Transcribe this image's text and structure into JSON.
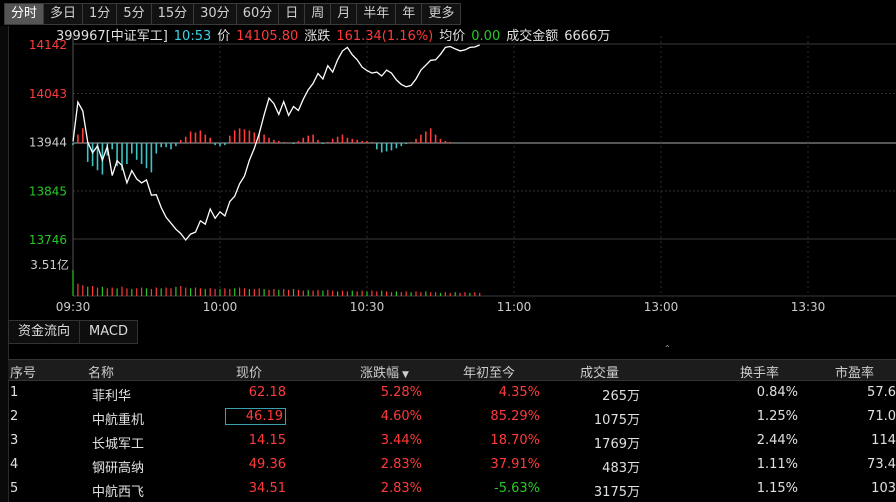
{
  "period_tabs": [
    "分时",
    "多日",
    "1分",
    "5分",
    "15分",
    "30分",
    "60分",
    "日",
    "周",
    "月",
    "半年",
    "年",
    "更多"
  ],
  "active_tab": "分时",
  "info": {
    "code": "399967[中证军工]",
    "time": "10:53",
    "price_label": "价",
    "price": "14105.80",
    "change_label": "涨跌",
    "change": "161.34(1.16%)",
    "avg_label": "均价",
    "avg": "0.00",
    "turnover_label": "成交金额",
    "turnover": "6666万"
  },
  "price_axis": [
    "14142",
    "14043",
    "13944",
    "13845",
    "13746"
  ],
  "volume_axis_label": "3.51亿",
  "time_axis": [
    "09:30",
    "10:00",
    "10:30",
    "11:00",
    "13:00",
    "13:30"
  ],
  "colors": {
    "up": "#ff3b3b",
    "down": "#26c926",
    "macd_down": "#3ec4c4",
    "line": "#ffffff",
    "cyan": "#3cd4e0"
  },
  "chart_data": {
    "type": "line",
    "x_range": [
      "09:30",
      "13:30"
    ],
    "y_range": [
      13746,
      14142
    ],
    "price_minutes": [
      0,
      1,
      2,
      3,
      4,
      5,
      6,
      7,
      8,
      9,
      10,
      11,
      12,
      13,
      14,
      15,
      16,
      17,
      18,
      19,
      20,
      21,
      22,
      23,
      24,
      25,
      26,
      27,
      28,
      29,
      30,
      31,
      32,
      33,
      34,
      35,
      36,
      37,
      38,
      39,
      40,
      41,
      42,
      43,
      44,
      45,
      46,
      47,
      48,
      49,
      50,
      51,
      52,
      53,
      54,
      55,
      56,
      57,
      58,
      59,
      60,
      61,
      62,
      63,
      64,
      65,
      66,
      67,
      68,
      69,
      70,
      71,
      72,
      73,
      74,
      75,
      76,
      77,
      78,
      79,
      80,
      81,
      82,
      83
    ],
    "price_values": [
      13944,
      14024,
      14006,
      13943,
      13921,
      13935,
      13906,
      13934,
      13875,
      13905,
      13895,
      13860,
      13885,
      13868,
      13860,
      13866,
      13835,
      13836,
      13810,
      13790,
      13778,
      13766,
      13757,
      13744,
      13756,
      13760,
      13783,
      13776,
      13807,
      13788,
      13801,
      13793,
      13822,
      13833,
      13858,
      13874,
      13906,
      13930,
      13960,
      13998,
      14032,
      14021,
      13999,
      14025,
      13997,
      14015,
      14007,
      14030,
      14049,
      14062,
      14082,
      14071,
      14098,
      14085,
      14110,
      14128,
      14135,
      14120,
      14110,
      14095,
      14088,
      14083,
      14085,
      14077,
      14089,
      14083,
      14069,
      14060,
      14055,
      14058,
      14071,
      14089,
      14099,
      14109,
      14110,
      14121,
      14135,
      14137,
      14132,
      14128,
      14130,
      14135,
      14136,
      14140
    ],
    "macd_values": [
      -2,
      8,
      14,
      -18,
      -22,
      -26,
      -30,
      -12,
      -6,
      -22,
      -26,
      -20,
      -10,
      -16,
      -20,
      -24,
      -28,
      -10,
      -4,
      -4,
      -6,
      -3,
      3,
      6,
      11,
      10,
      12,
      8,
      5,
      -2,
      -3,
      -2,
      7,
      12,
      14,
      13,
      12,
      10,
      9,
      8,
      5,
      3,
      2,
      1,
      0,
      -1,
      2,
      5,
      7,
      8,
      3,
      -1,
      1,
      4,
      6,
      8,
      5,
      4,
      3,
      2,
      2,
      1,
      -6,
      -9,
      -8,
      -7,
      -5,
      -3,
      -1,
      1,
      4,
      8,
      11,
      14,
      8,
      4,
      2,
      1,
      0,
      0,
      0,
      0,
      0,
      0
    ],
    "volume_series": [
      3.4,
      1.6,
      1.4,
      1.2,
      1.3,
      1.1,
      1.2,
      1.0,
      1.1,
      1.0,
      1.2,
      1.0,
      0.9,
      1.0,
      1.1,
      1.0,
      0.9,
      1.1,
      1.0,
      1.1,
      1.0,
      1.2,
      1.3,
      1.1,
      1.0,
      1.1,
      1.0,
      0.9,
      1.0,
      0.9,
      0.9,
      1.0,
      0.9,
      1.0,
      1.1,
      1.0,
      0.9,
      0.9,
      1.0,
      0.9,
      0.8,
      0.9,
      0.8,
      0.9,
      0.8,
      0.9,
      0.8,
      0.7,
      0.8,
      0.7,
      0.8,
      0.7,
      0.8,
      0.7,
      0.6,
      0.7,
      0.6,
      0.7,
      0.6,
      0.7,
      0.6,
      0.7,
      0.6,
      0.7,
      0.6,
      0.5,
      0.6,
      0.5,
      0.6,
      0.5,
      0.6,
      0.5,
      0.6,
      0.5,
      0.5,
      0.4,
      0.5,
      0.4,
      0.5,
      0.4,
      0.5,
      0.4,
      0.5,
      0.4
    ]
  },
  "bottom_tabs": [
    "资金流向",
    "MACD"
  ],
  "table": {
    "headers": [
      "序号",
      "名称",
      "现价",
      "涨跌幅",
      "年初至今",
      "成交量",
      "换手率",
      "市盈率"
    ],
    "sort_indicator": "▼",
    "rows": [
      {
        "rank": "1",
        "name": "菲利华",
        "price": "62.18",
        "change": "5.28%",
        "ytd": "4.35%",
        "volume": "265万",
        "turnover": "0.84%",
        "pe": "57.6",
        "ytd_dir": "up"
      },
      {
        "rank": "2",
        "name": "中航重机",
        "price": "46.19",
        "change": "4.60%",
        "ytd": "85.29%",
        "volume": "1075万",
        "turnover": "1.25%",
        "pe": "71.0",
        "ytd_dir": "up"
      },
      {
        "rank": "3",
        "name": "长城军工",
        "price": "14.15",
        "change": "3.44%",
        "ytd": "18.70%",
        "volume": "1769万",
        "turnover": "2.44%",
        "pe": "114",
        "ytd_dir": "up"
      },
      {
        "rank": "4",
        "name": "钢研高纳",
        "price": "49.36",
        "change": "2.83%",
        "ytd": "37.91%",
        "volume": "483万",
        "turnover": "1.11%",
        "pe": "73.4",
        "ytd_dir": "up"
      },
      {
        "rank": "5",
        "name": "中航西飞",
        "price": "34.51",
        "change": "2.83%",
        "ytd": "-5.63%",
        "volume": "3175万",
        "turnover": "1.15%",
        "pe": "103",
        "ytd_dir": "down"
      }
    ]
  }
}
